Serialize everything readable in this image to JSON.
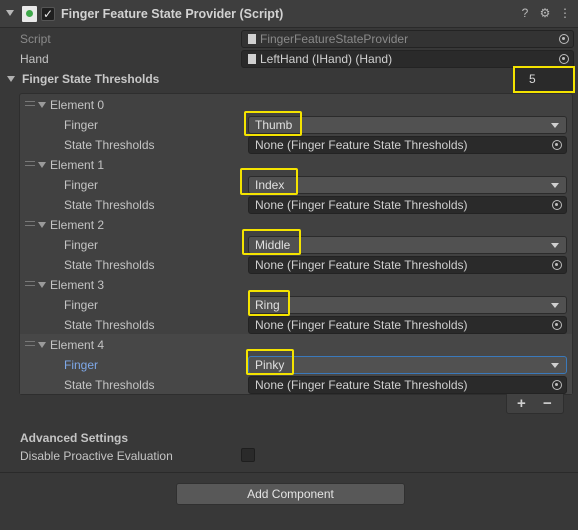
{
  "component": {
    "title": "Finger Feature State Provider (Script)",
    "enabled_check": "✓",
    "help_icon": "?",
    "settings_icon": "⚙",
    "more_icon": "⋮"
  },
  "fields": {
    "script_label": "Script",
    "script_value": "FingerFeatureStateProvider",
    "hand_label": "Hand",
    "hand_value": "LeftHand (IHand) (Hand)"
  },
  "thresholds": {
    "label": "Finger State Thresholds",
    "size": "5",
    "finger_label": "Finger",
    "state_label": "State Thresholds",
    "elements": [
      {
        "title": "Element 0",
        "finger": "Thumb",
        "state": "None (Finger Feature State Thresholds)"
      },
      {
        "title": "Element 1",
        "finger": "Index",
        "state": "None (Finger Feature State Thresholds)"
      },
      {
        "title": "Element 2",
        "finger": "Middle",
        "state": "None (Finger Feature State Thresholds)"
      },
      {
        "title": "Element 3",
        "finger": "Ring",
        "state": "None (Finger Feature State Thresholds)"
      },
      {
        "title": "Element 4",
        "finger": "Pinky",
        "state": "None (Finger Feature State Thresholds)"
      }
    ],
    "add_label": "+",
    "remove_label": "−"
  },
  "advanced": {
    "title": "Advanced Settings",
    "disable_proactive_label": "Disable Proactive Evaluation",
    "disable_proactive_checked": false
  },
  "add_component_label": "Add Component",
  "colors": {
    "highlight": "#f4e300",
    "active_label": "#7ea8e8",
    "background": "#383838"
  }
}
